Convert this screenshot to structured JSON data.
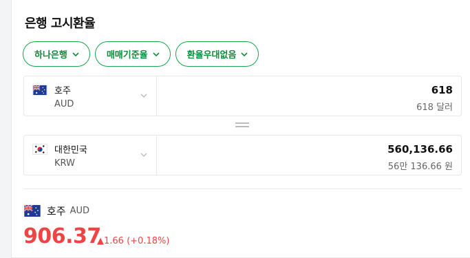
{
  "title": "은행 고시환율",
  "filters": [
    {
      "label": "하나은행"
    },
    {
      "label": "매매기준율"
    },
    {
      "label": "환율우대없음"
    }
  ],
  "from": {
    "name": "호주",
    "code": "AUD",
    "value": "618",
    "sub": "618 달러",
    "flag_icon": "australia-flag-icon"
  },
  "to": {
    "name": "대한민국",
    "code": "KRW",
    "value": "560,136.66",
    "sub": "56만 136.66 원",
    "flag_icon": "south-korea-flag-icon"
  },
  "rate": {
    "name": "호주",
    "code": "AUD",
    "value": "906.37",
    "change": "▲1.66 (+0.18%)"
  },
  "colors": {
    "accent": "#16a34a",
    "up": "#ef4444",
    "border": "#e5e7eb"
  }
}
